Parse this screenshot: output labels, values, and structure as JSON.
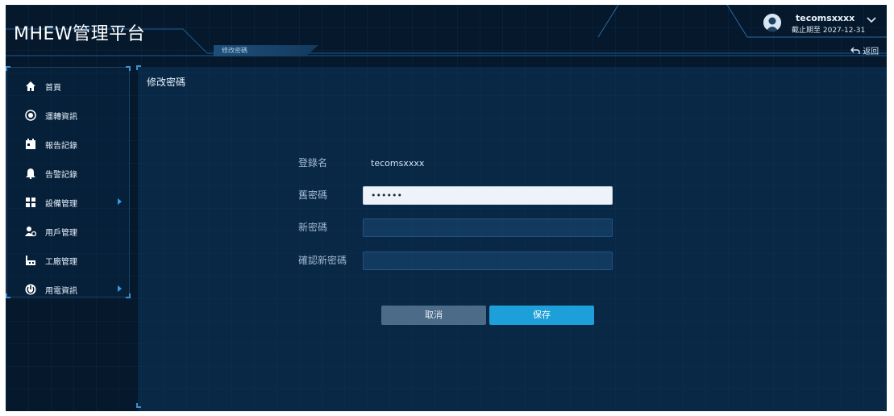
{
  "app": {
    "title": "MHEW管理平台"
  },
  "header": {
    "active_tab": "修改密碼",
    "back_label": "返回",
    "back_icon": "undo-arrow-icon"
  },
  "user": {
    "name": "tecomsxxxx",
    "expiry": "截止期至 2027-12-31",
    "avatar_icon": "user-avatar-icon",
    "dropdown_icon": "chevron-down-icon"
  },
  "sidebar": {
    "items": [
      {
        "label": "首頁",
        "icon": "home-icon",
        "has_submenu": false
      },
      {
        "label": "運轉資訊",
        "icon": "globe-icon",
        "has_submenu": false
      },
      {
        "label": "報告記錄",
        "icon": "calendar-icon",
        "has_submenu": false
      },
      {
        "label": "告警記錄",
        "icon": "bell-icon",
        "has_submenu": false
      },
      {
        "label": "設備管理",
        "icon": "grid-icon",
        "has_submenu": true
      },
      {
        "label": "用戶管理",
        "icon": "users-icon",
        "has_submenu": false
      },
      {
        "label": "工廠管理",
        "icon": "factory-icon",
        "has_submenu": false
      },
      {
        "label": "用電資訊",
        "icon": "power-icon",
        "has_submenu": true
      }
    ]
  },
  "main": {
    "title": "修改密碼",
    "form": {
      "username_label": "登錄名",
      "username_value": "tecomsxxxx",
      "old_password_label": "舊密碼",
      "old_password_value": "••••••",
      "new_password_label": "新密碼",
      "new_password_value": "",
      "confirm_password_label": "確認新密碼",
      "confirm_password_value": ""
    },
    "cancel_label": "取消",
    "save_label": "保存"
  },
  "colors": {
    "background": "#05182c",
    "panel": "#0c375c",
    "accent": "#1d9fd9",
    "cancel": "#4c6b88"
  }
}
